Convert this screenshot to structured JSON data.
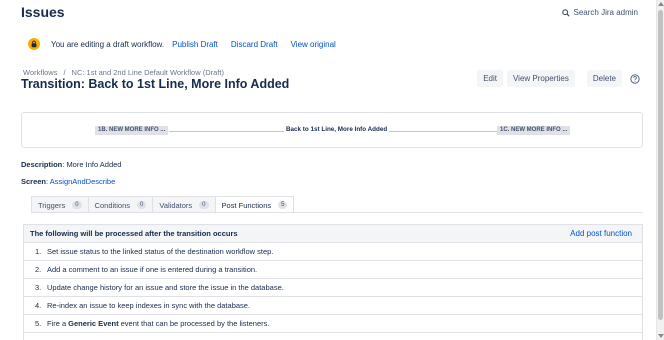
{
  "header": {
    "title": "Issues",
    "search_label": "Search Jira admin"
  },
  "draft_banner": {
    "message": "You are editing a draft workflow.",
    "links": [
      "Publish Draft",
      "Discard Draft",
      "View original"
    ]
  },
  "breadcrumb": {
    "root": "Workflows",
    "separator": "/",
    "current": "NC: 1st and 2nd Line Default Workflow (Draft)"
  },
  "transition": {
    "title": "Transition: Back to 1st Line, More Info Added"
  },
  "actions": {
    "edit": "Edit",
    "view_properties": "View Properties",
    "delete": "Delete"
  },
  "diagram": {
    "from_status": "1B. NEW MORE INFO ...",
    "transition_label": "Back to 1st Line, More Info Added",
    "to_status": "1C. NEW MORE INFO ..."
  },
  "details": {
    "description_label": "Description",
    "description_value": "More Info Added",
    "screen_label": "Screen",
    "screen_value": "AssignAndDescribe"
  },
  "tabs": [
    {
      "label": "Triggers",
      "count": "0"
    },
    {
      "label": "Conditions",
      "count": "0"
    },
    {
      "label": "Validators",
      "count": "0"
    },
    {
      "label": "Post Functions",
      "count": "5"
    }
  ],
  "post_functions": {
    "header": "The following will be processed after the transition occurs",
    "add_label": "Add post function",
    "items": [
      {
        "num": "1.",
        "text": "Set issue status to the linked status of the destination workflow step."
      },
      {
        "num": "2.",
        "text": "Add a comment to an issue if one is entered during a transition."
      },
      {
        "num": "3.",
        "text": "Update change history for an issue and store the issue in the database."
      },
      {
        "num": "4.",
        "text": "Re-index an issue to keep indexes in sync with the database."
      },
      {
        "num": "5.",
        "pre": "Fire a",
        "bold": "Generic Event",
        "post": "event that can be processed by the listeners."
      }
    ]
  },
  "colors": {
    "link": "#0052cc",
    "text": "#172b4d",
    "warning": "#ffab00",
    "lozenge": "#dfe1e6"
  }
}
